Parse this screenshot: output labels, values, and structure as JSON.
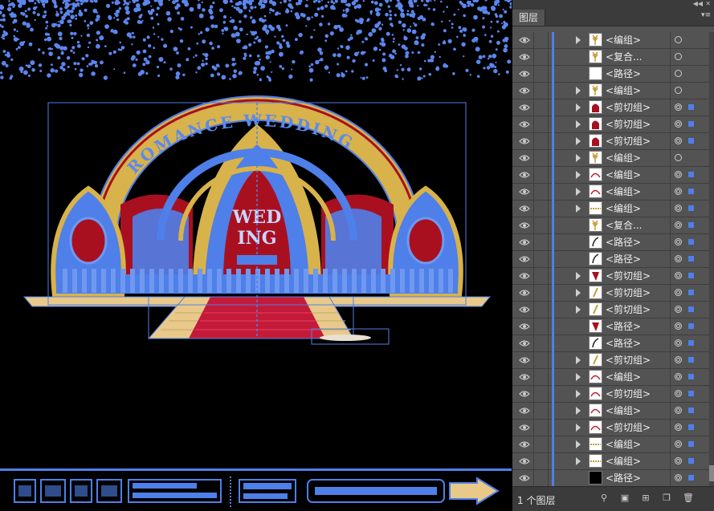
{
  "panel": {
    "tab_label": "图层",
    "layer_count": "1 个图层",
    "rows": [
      {
        "label": "<编组>",
        "expand": true,
        "thumb": "wheat",
        "target": "single",
        "selected": false
      },
      {
        "label": "<复合...",
        "expand": false,
        "thumb": "wheat",
        "target": "single",
        "selected": false
      },
      {
        "label": "<路径>",
        "expand": false,
        "thumb": "white",
        "target": "single",
        "selected": false
      },
      {
        "label": "<编组>",
        "expand": true,
        "thumb": "wheat",
        "target": "single",
        "selected": false
      },
      {
        "label": "<剪切组>",
        "expand": true,
        "thumb": "red",
        "target": "double",
        "selected": true
      },
      {
        "label": "<剪切组>",
        "expand": true,
        "thumb": "red",
        "target": "double",
        "selected": true
      },
      {
        "label": "<剪切组>",
        "expand": true,
        "thumb": "red",
        "target": "double",
        "selected": true
      },
      {
        "label": "<编组>",
        "expand": true,
        "thumb": "wheat",
        "target": "single",
        "selected": false
      },
      {
        "label": "<编组>",
        "expand": true,
        "thumb": "arc",
        "target": "double",
        "selected": true
      },
      {
        "label": "<编组>",
        "expand": true,
        "thumb": "arc",
        "target": "double",
        "selected": true
      },
      {
        "label": "<编组>",
        "expand": true,
        "thumb": "dash",
        "target": "double",
        "selected": true
      },
      {
        "label": "<复合...",
        "expand": false,
        "thumb": "wheat",
        "target": "double",
        "selected": true
      },
      {
        "label": "<路径>",
        "expand": false,
        "thumb": "curve",
        "target": "double",
        "selected": true
      },
      {
        "label": "<路径>",
        "expand": false,
        "thumb": "curve",
        "target": "double",
        "selected": true
      },
      {
        "label": "<剪切组>",
        "expand": true,
        "thumb": "redcone",
        "target": "double",
        "selected": true
      },
      {
        "label": "<剪切组>",
        "expand": true,
        "thumb": "stick",
        "target": "double",
        "selected": true
      },
      {
        "label": "<剪切组>",
        "expand": true,
        "thumb": "stick",
        "target": "double",
        "selected": true
      },
      {
        "label": "<路径>",
        "expand": false,
        "thumb": "redcone",
        "target": "double",
        "selected": true
      },
      {
        "label": "<路径>",
        "expand": false,
        "thumb": "curve",
        "target": "double",
        "selected": true
      },
      {
        "label": "<剪切组>",
        "expand": true,
        "thumb": "stick",
        "target": "double",
        "selected": true
      },
      {
        "label": "<编组>",
        "expand": true,
        "thumb": "arc",
        "target": "double",
        "selected": true
      },
      {
        "label": "<剪切组>",
        "expand": true,
        "thumb": "arc",
        "target": "double",
        "selected": true
      },
      {
        "label": "<编组>",
        "expand": true,
        "thumb": "arc",
        "target": "double",
        "selected": true
      },
      {
        "label": "<剪切组>",
        "expand": true,
        "thumb": "arc",
        "target": "double",
        "selected": true
      },
      {
        "label": "<编组>",
        "expand": true,
        "thumb": "dash",
        "target": "double",
        "selected": true
      },
      {
        "label": "<编组>",
        "expand": true,
        "thumb": "dash",
        "target": "double",
        "selected": true
      },
      {
        "label": "<路径>",
        "expand": false,
        "thumb": "black",
        "target": "double",
        "selected": true
      }
    ]
  },
  "artwork": {
    "arch_text": "ROMANCE WEDDING",
    "center_text_1": "WED",
    "center_text_2": "ING",
    "colors": {
      "selection": "#4f7fe8",
      "red": "#a81020",
      "gold": "#d8b24a",
      "floor": "#e8c98a"
    }
  }
}
